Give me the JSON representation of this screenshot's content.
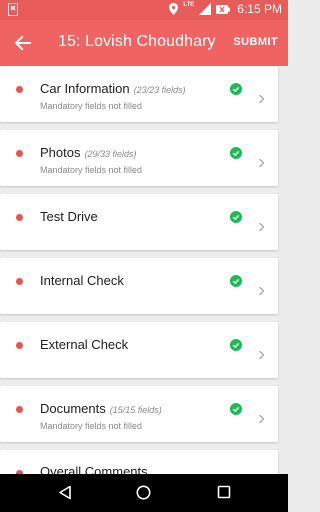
{
  "status_bar": {
    "notification_icon": "notification-icon",
    "network_label": "LTE",
    "time": "6:15 PM"
  },
  "app_bar": {
    "title": "15: Lovish Choudhary",
    "submit_label": "SUBMIT"
  },
  "sections": [
    {
      "name": "Car Information",
      "fields": "(23/23 fields)",
      "subtitle": "Mandatory fields not filled"
    },
    {
      "name": "Photos",
      "fields": "(29/33 fields)",
      "subtitle": "Mandatory fields not filled"
    },
    {
      "name": "Test Drive",
      "fields": "",
      "subtitle": ""
    },
    {
      "name": "Internal Check",
      "fields": "",
      "subtitle": ""
    },
    {
      "name": "External Check",
      "fields": "",
      "subtitle": ""
    },
    {
      "name": "Documents",
      "fields": "(15/15 fields)",
      "subtitle": "Mandatory fields not filled"
    },
    {
      "name": "Overall Comments",
      "fields": "",
      "subtitle": ""
    }
  ],
  "colors": {
    "status_bar": "#e85b5b",
    "app_bar": "#ef6363",
    "status_dot": "#e25555",
    "check": "#1db954"
  }
}
